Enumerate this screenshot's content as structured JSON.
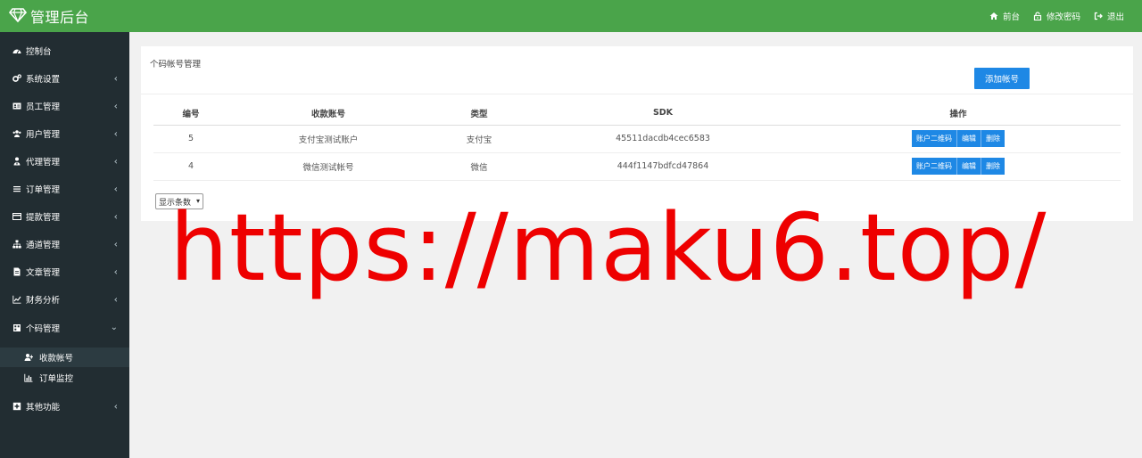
{
  "header": {
    "brand_title": "管理后台",
    "nav": [
      {
        "label": "前台",
        "icon": "home-icon"
      },
      {
        "label": "修改密码",
        "icon": "lock-icon"
      },
      {
        "label": "退出",
        "icon": "sign-out-icon"
      }
    ],
    "colors": {
      "header_bg": "#4aa44a",
      "sidebar_bg": "#222d32",
      "button_blue": "#1e88e5"
    }
  },
  "sidebar": {
    "items": [
      {
        "label": "控制台",
        "icon": "dashboard-icon",
        "has_arrow": false
      },
      {
        "label": "系统设置",
        "icon": "cogs-icon",
        "has_arrow": true
      },
      {
        "label": "员工管理",
        "icon": "id-card-icon",
        "has_arrow": true
      },
      {
        "label": "用户管理",
        "icon": "users-icon",
        "has_arrow": true
      },
      {
        "label": "代理管理",
        "icon": "user-tie-icon",
        "has_arrow": true
      },
      {
        "label": "订单管理",
        "icon": "list-icon",
        "has_arrow": true
      },
      {
        "label": "提款管理",
        "icon": "credit-card-icon",
        "has_arrow": true
      },
      {
        "label": "通道管理",
        "icon": "sitemap-icon",
        "has_arrow": true
      },
      {
        "label": "文章管理",
        "icon": "file-icon",
        "has_arrow": true
      },
      {
        "label": "财务分析",
        "icon": "line-chart-icon",
        "has_arrow": true
      },
      {
        "label": "个码管理",
        "icon": "qrcode-icon",
        "has_arrow": true,
        "expanded": true
      },
      {
        "label": "其他功能",
        "icon": "plus-square-icon",
        "has_arrow": true
      }
    ],
    "subitems": [
      {
        "label": "收款帐号",
        "icon": "user-plus-icon",
        "active": true
      },
      {
        "label": "订单监控",
        "icon": "bar-chart-icon",
        "active": false
      }
    ],
    "arrow_collapsed": "‹",
    "arrow_expanded": "⌄"
  },
  "main": {
    "box_title": "个码帐号管理",
    "add_button": "添加帐号",
    "table": {
      "columns": [
        "编号",
        "收款账号",
        "类型",
        "SDK",
        "操作"
      ],
      "rows": [
        {
          "id": "5",
          "account": "支付宝测试账户",
          "type": "支付宝",
          "sdk": "45511dacdb4cec6583"
        },
        {
          "id": "4",
          "account": "微信测试帐号",
          "type": "微信",
          "sdk": "444f1147bdfcd47864"
        }
      ],
      "row_actions": [
        "账户二维码",
        "编辑",
        "删除"
      ]
    },
    "page_size_select": "显示条数"
  },
  "watermark": "https://maku6.top/"
}
